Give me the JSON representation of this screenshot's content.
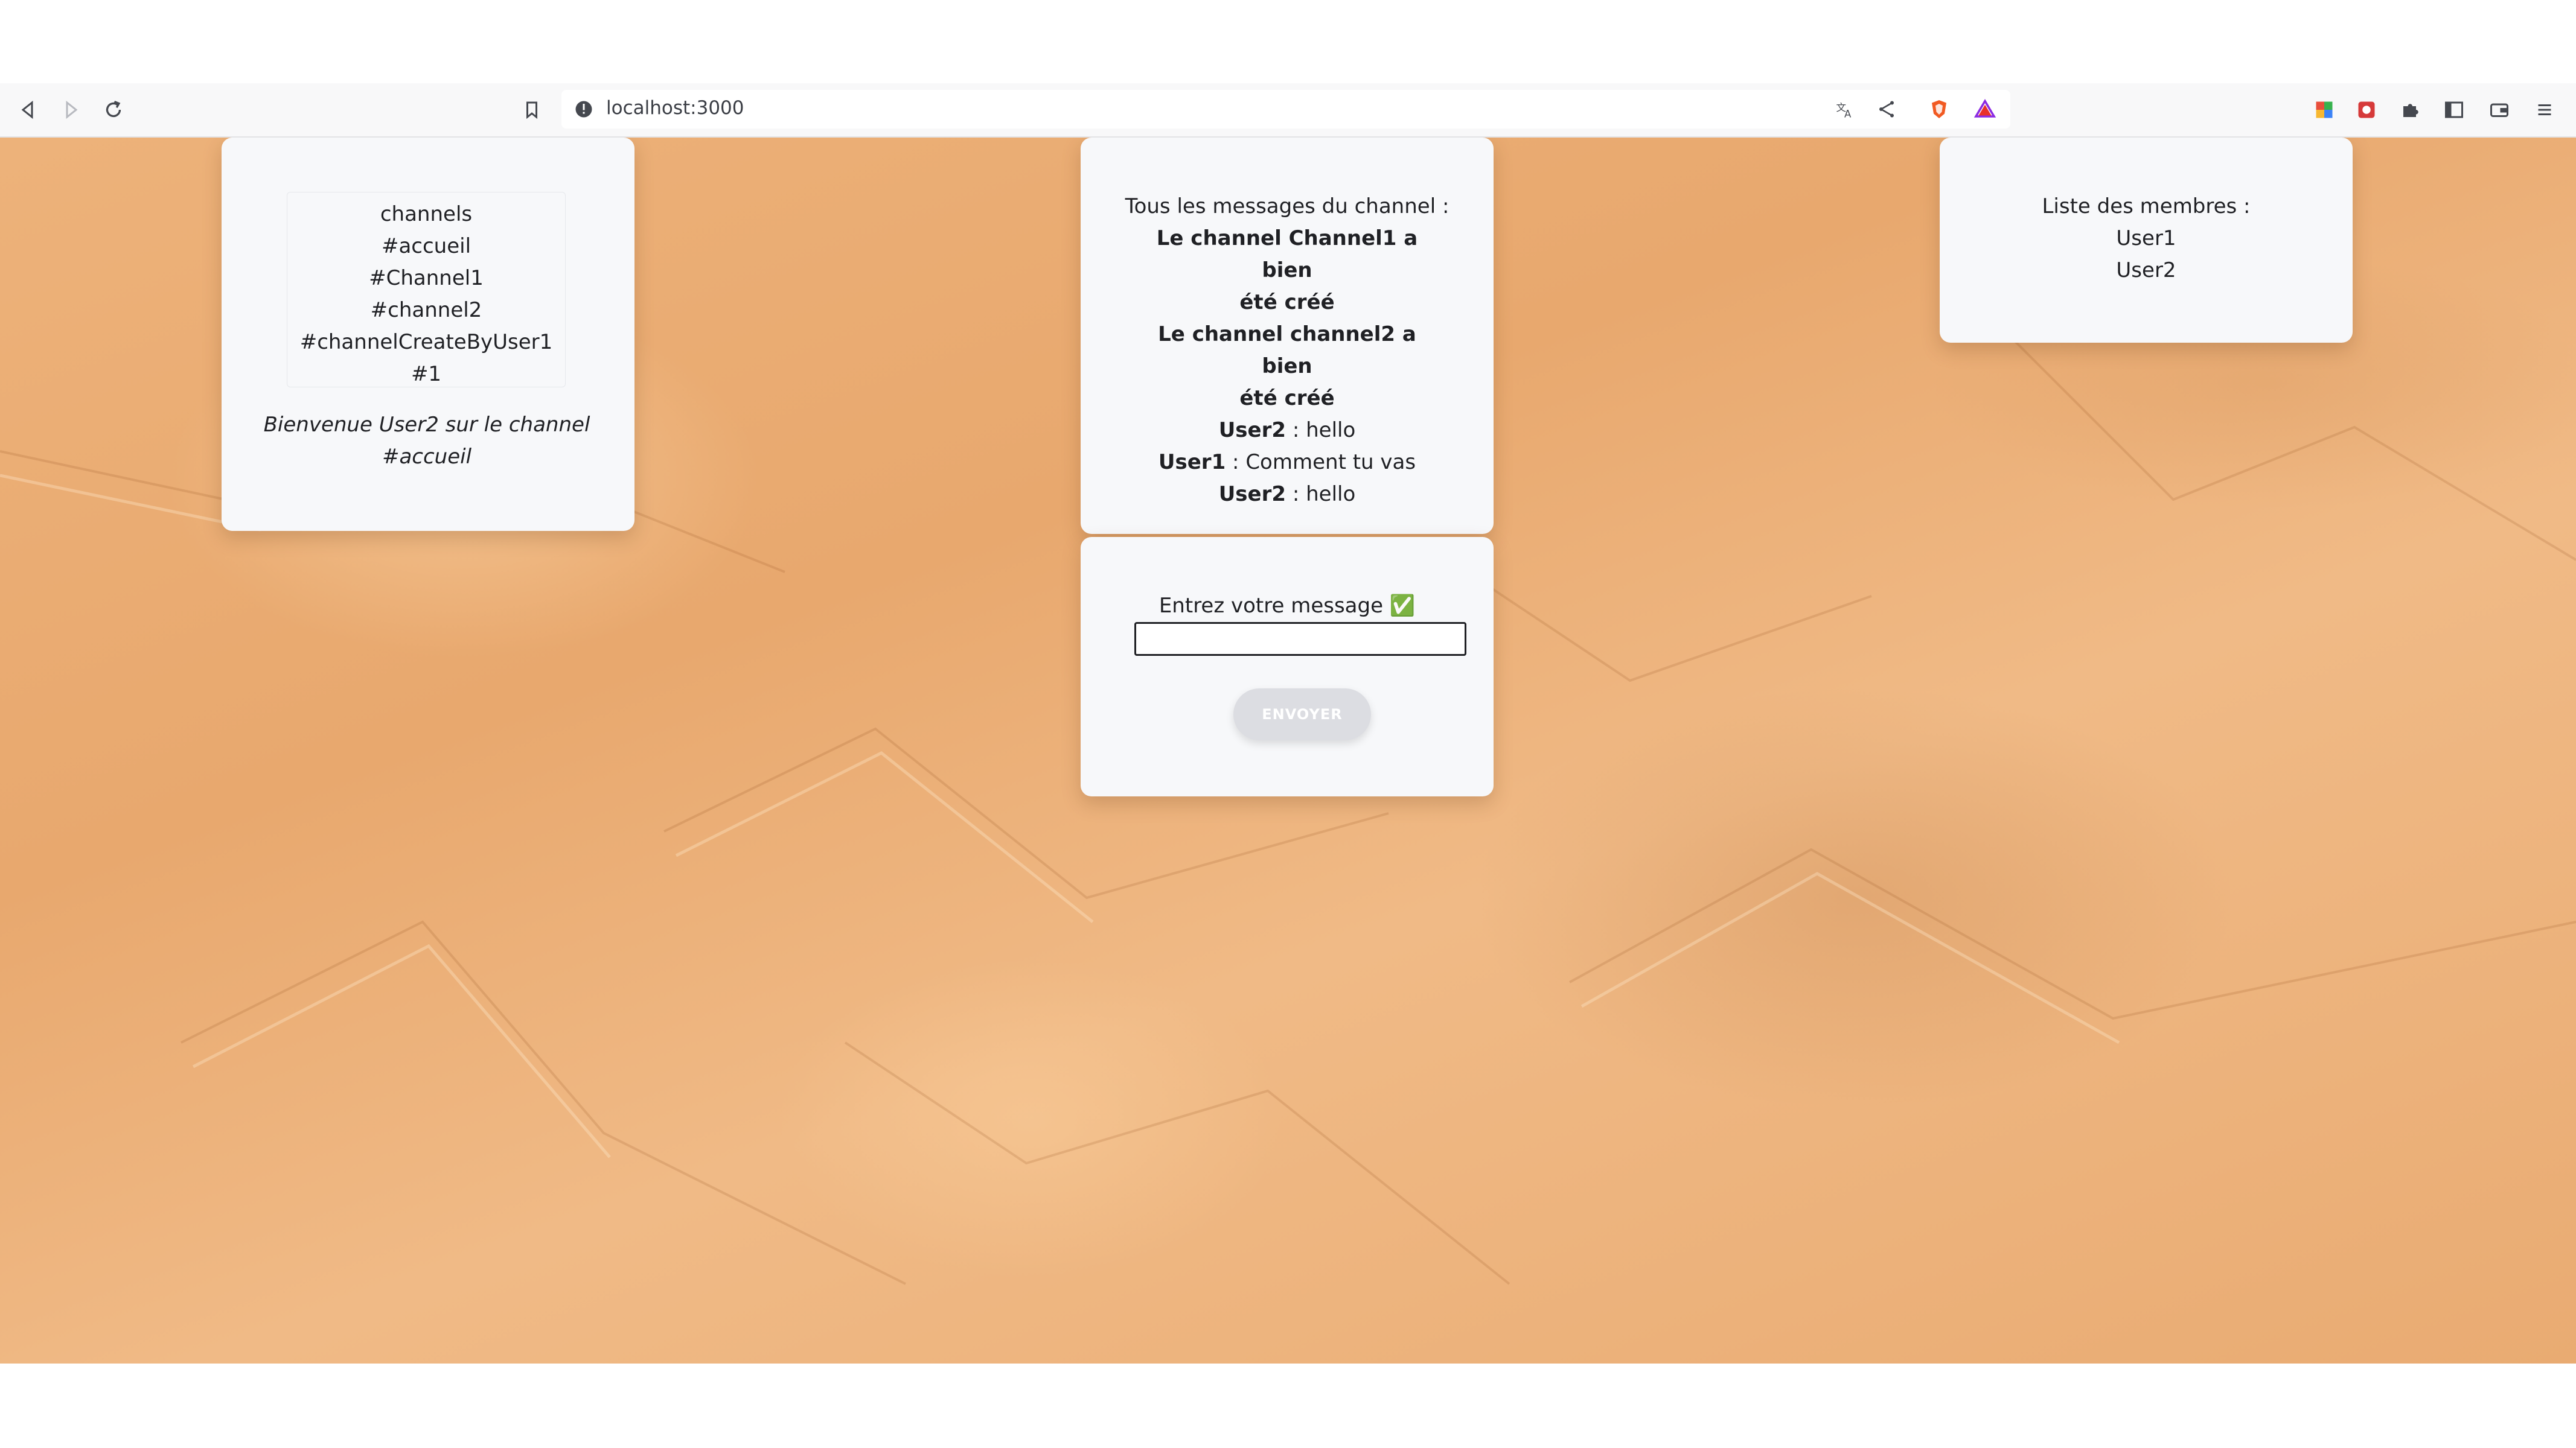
{
  "browser": {
    "url": "localhost:3000",
    "icons": [
      "back-icon",
      "forward-icon",
      "reload-icon",
      "bookmark-icon",
      "site-info-icon",
      "translate-icon",
      "share-icon",
      "brave-shield-icon",
      "brave-rewards-icon",
      "extension-color-icon",
      "extension-red-icon",
      "puzzle-icon",
      "sidebar-icon",
      "wallet-icon",
      "menu-icon"
    ]
  },
  "channels": {
    "header": "channels",
    "items": [
      "#accueil",
      "#Channel1",
      "#channel2",
      "#channelCreateByUser1",
      "#1"
    ],
    "welcome_line1": "Bienvenue User2 sur le channel",
    "welcome_line2": "#accueil"
  },
  "messages": {
    "title": "Tous les messages du channel :",
    "system": [
      {
        "line1": "Le channel Channel1 a bien",
        "line2": "été créé"
      },
      {
        "line1": "Le channel channel2 a bien",
        "line2": "été créé"
      }
    ],
    "items": [
      {
        "author": "User2",
        "text": " : hello"
      },
      {
        "author": "User1",
        "text": " : Comment tu vas"
      },
      {
        "author": "User2",
        "text": " : hello"
      }
    ]
  },
  "composer": {
    "label": "Entrez votre message ✅",
    "input_value": "",
    "send_label": "ENVOYER"
  },
  "members": {
    "title": "Liste des membres :",
    "items": [
      "User1",
      "User2"
    ]
  }
}
